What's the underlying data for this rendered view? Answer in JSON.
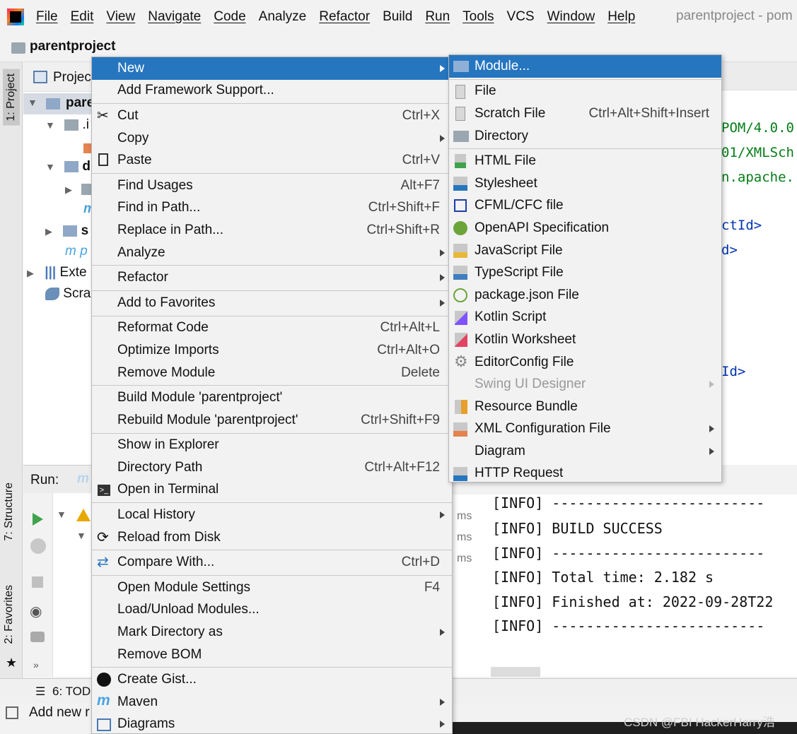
{
  "menubar": {
    "items": [
      "File",
      "Edit",
      "View",
      "Navigate",
      "Code",
      "Analyze",
      "Refactor",
      "Build",
      "Run",
      "Tools",
      "VCS",
      "Window",
      "Help"
    ],
    "window_title": "parentproject - pom"
  },
  "breadcrumb": {
    "project": "parentproject"
  },
  "left_tabs": {
    "project": "1: Project",
    "structure": "7: Structure",
    "favorites": "2: Favorites"
  },
  "project_panel": {
    "title": "Projec",
    "rows": [
      {
        "text": "pare"
      },
      {
        "text": ".i"
      },
      {
        "text": "d"
      },
      {
        "text": "m"
      },
      {
        "text": "s"
      },
      {
        "text": "m p"
      },
      {
        "text": "Exte"
      },
      {
        "text": "Scra"
      }
    ]
  },
  "editor": {
    "lines": [
      "POM/4.0.0",
      "01/XMLSch",
      "n.apache.",
      "ctId>",
      "d>",
      "Id>"
    ]
  },
  "run_panel": {
    "label": "Run:",
    "ms": [
      "ms",
      "ms",
      "ms"
    ]
  },
  "console": {
    "lines": [
      "[INFO] -------------------------",
      "[INFO] BUILD SUCCESS",
      "[INFO] -------------------------",
      "[INFO] Total time:  2.182 s",
      "[INFO] Finished at: 2022-09-28T22",
      "[INFO] -------------------------"
    ]
  },
  "bottom": {
    "todo": "6: TODO",
    "status": "Add new r"
  },
  "watermark": "CSDN @FBI HackerHarry浩",
  "context_menu": {
    "groups": [
      [
        {
          "label": "New",
          "submenu": true,
          "highlight": true
        },
        {
          "label": "Add Framework Support..."
        }
      ],
      [
        {
          "label": "Cut",
          "shortcut": "Ctrl+X",
          "icon": "scissors-icon"
        },
        {
          "label": "Copy",
          "submenu": true
        },
        {
          "label": "Paste",
          "shortcut": "Ctrl+V",
          "icon": "clipboard-icon"
        }
      ],
      [
        {
          "label": "Find Usages",
          "shortcut": "Alt+F7"
        },
        {
          "label": "Find in Path...",
          "shortcut": "Ctrl+Shift+F"
        },
        {
          "label": "Replace in Path...",
          "shortcut": "Ctrl+Shift+R"
        },
        {
          "label": "Analyze",
          "submenu": true
        }
      ],
      [
        {
          "label": "Refactor",
          "submenu": true
        }
      ],
      [
        {
          "label": "Add to Favorites",
          "submenu": true
        }
      ],
      [
        {
          "label": "Reformat Code",
          "shortcut": "Ctrl+Alt+L"
        },
        {
          "label": "Optimize Imports",
          "shortcut": "Ctrl+Alt+O"
        },
        {
          "label": "Remove Module",
          "shortcut": "Delete"
        }
      ],
      [
        {
          "label": "Build Module 'parentproject'"
        },
        {
          "label": "Rebuild Module 'parentproject'",
          "shortcut": "Ctrl+Shift+F9"
        }
      ],
      [
        {
          "label": "Show in Explorer"
        },
        {
          "label": "Directory Path",
          "shortcut": "Ctrl+Alt+F12"
        },
        {
          "label": "Open in Terminal",
          "icon": "terminal-icon"
        }
      ],
      [
        {
          "label": "Local History",
          "submenu": true
        },
        {
          "label": "Reload from Disk",
          "icon": "reload-icon"
        }
      ],
      [
        {
          "label": "Compare With...",
          "shortcut": "Ctrl+D",
          "icon": "compare-icon"
        }
      ],
      [
        {
          "label": "Open Module Settings",
          "shortcut": "F4"
        },
        {
          "label": "Load/Unload Modules..."
        },
        {
          "label": "Mark Directory as",
          "submenu": true
        },
        {
          "label": "Remove BOM"
        }
      ],
      [
        {
          "label": "Create Gist...",
          "icon": "github-icon"
        },
        {
          "label": "Maven",
          "submenu": true,
          "icon": "maven-icon"
        },
        {
          "label": "Diagrams",
          "submenu": true,
          "icon": "diagram-icon"
        }
      ]
    ]
  },
  "new_submenu": {
    "groups": [
      [
        {
          "label": "Module...",
          "highlight": true,
          "icon": "module-icon"
        }
      ],
      [
        {
          "label": "File",
          "icon": "file-icon"
        },
        {
          "label": "Scratch File",
          "shortcut": "Ctrl+Alt+Shift+Insert",
          "icon": "scratch-file-icon"
        },
        {
          "label": "Directory",
          "icon": "folder-icon"
        }
      ],
      [
        {
          "label": "HTML File",
          "icon": "html-file-icon"
        },
        {
          "label": "Stylesheet",
          "icon": "css-file-icon"
        },
        {
          "label": "CFML/CFC file",
          "icon": "cfml-file-icon"
        },
        {
          "label": "OpenAPI Specification",
          "icon": "openapi-icon"
        },
        {
          "label": "JavaScript File",
          "icon": "js-file-icon"
        },
        {
          "label": "TypeScript File",
          "icon": "ts-file-icon"
        },
        {
          "label": "package.json File",
          "icon": "nodejs-icon"
        },
        {
          "label": "Kotlin Script",
          "icon": "kotlin-script-icon"
        },
        {
          "label": "Kotlin Worksheet",
          "icon": "kotlin-worksheet-icon"
        },
        {
          "label": "EditorConfig File",
          "icon": "gear-icon"
        },
        {
          "label": "Swing UI Designer",
          "submenu": true,
          "disabled": true
        },
        {
          "label": "Resource Bundle",
          "icon": "resource-bundle-icon"
        },
        {
          "label": "XML Configuration File",
          "submenu": true,
          "icon": "xml-file-icon"
        },
        {
          "label": "Diagram",
          "submenu": true
        },
        {
          "label": "HTTP Request",
          "icon": "api-icon"
        }
      ]
    ]
  },
  "colors": {
    "highlight": "#2675bf",
    "menu_bg": "#f2f2f2",
    "accent_blue": "#1a3fa8"
  }
}
